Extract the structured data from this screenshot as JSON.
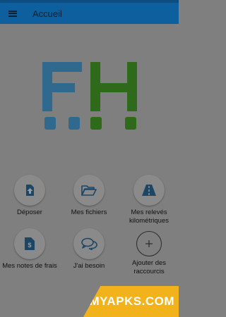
{
  "appbar": {
    "title": "Accueil",
    "menu_icon": "hamburger-menu-icon"
  },
  "tiles": [
    {
      "label": "Déposer",
      "icon": "upload-icon"
    },
    {
      "label": "Mes fichiers",
      "icon": "folder-open-icon"
    },
    {
      "label": "Mes relevés kilométriques",
      "icon": "road-icon"
    },
    {
      "label": "Mes notes de frais",
      "icon": "receipt-dollar-icon"
    },
    {
      "label": "J'ai besoin",
      "icon": "chat-bubbles-icon"
    },
    {
      "label": "Ajouter des raccourcis",
      "icon": "plus-icon"
    }
  ],
  "logo": {
    "letters": "FH"
  },
  "watermark": {
    "text": "MYAPKS.COM"
  },
  "colors": {
    "appbar": "#0d5f9e",
    "icon_blue": "#1c4666",
    "logo_blue": "#2f6a8e",
    "logo_green": "#2f6a1a",
    "watermark": "#f2b21b"
  }
}
